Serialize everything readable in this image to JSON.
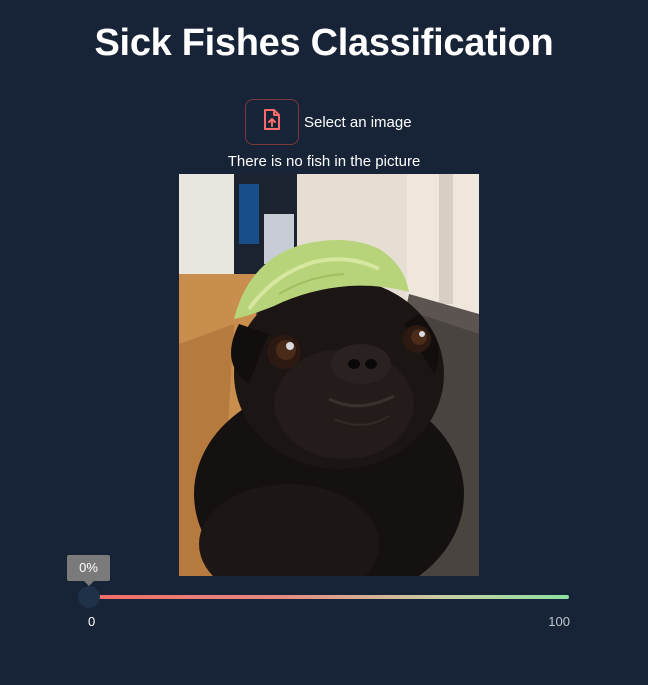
{
  "header": {
    "title": "Sick Fishes Classification"
  },
  "uploader": {
    "label": "Select an image",
    "icon": "file-upload-icon",
    "accent_color": "#ff6b6b"
  },
  "result": {
    "message": "There is no fish in the picture"
  },
  "image": {
    "description": "Black pug with a lettuce leaf on its head"
  },
  "slider": {
    "value": 0,
    "value_label": "0%",
    "min_label": "0",
    "max_label": "100",
    "colors": {
      "start": "#f26b6b",
      "end": "#8de0a1"
    }
  }
}
